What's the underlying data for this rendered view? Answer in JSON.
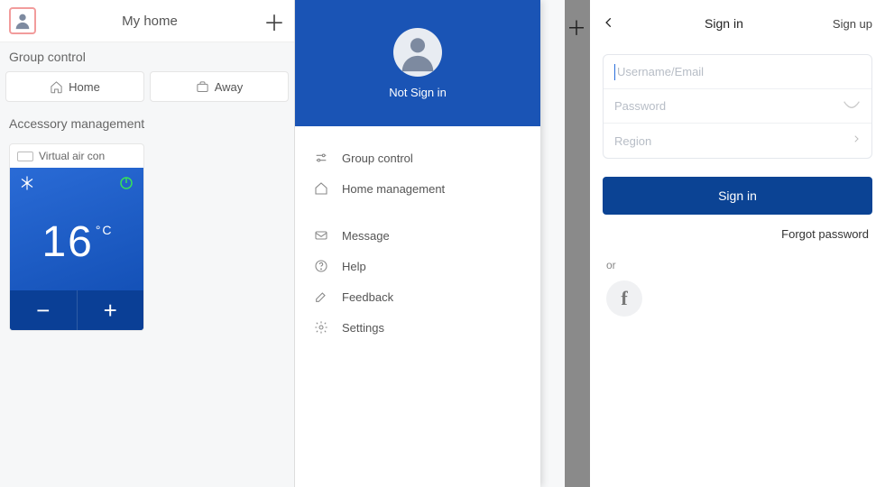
{
  "home": {
    "title": "My home",
    "group_control_label": "Group control",
    "home_btn": "Home",
    "away_btn": "Away",
    "accessory_label": "Accessory management",
    "device_name": "Virtual air con",
    "temp_value": "16",
    "temp_unit": "°C",
    "minus": "−",
    "plus": "+"
  },
  "drawer": {
    "not_signed": "Not Sign in",
    "items_a": [
      "Group control",
      "Home management"
    ],
    "items_b": [
      "Message",
      "Help",
      "Feedback",
      "Settings"
    ]
  },
  "signin": {
    "title": "Sign in",
    "signup": "Sign up",
    "ph_user": "Username/Email",
    "ph_pass": "Password",
    "ph_region": "Region",
    "btn": "Sign in",
    "forgot": "Forgot password",
    "or": "or"
  }
}
